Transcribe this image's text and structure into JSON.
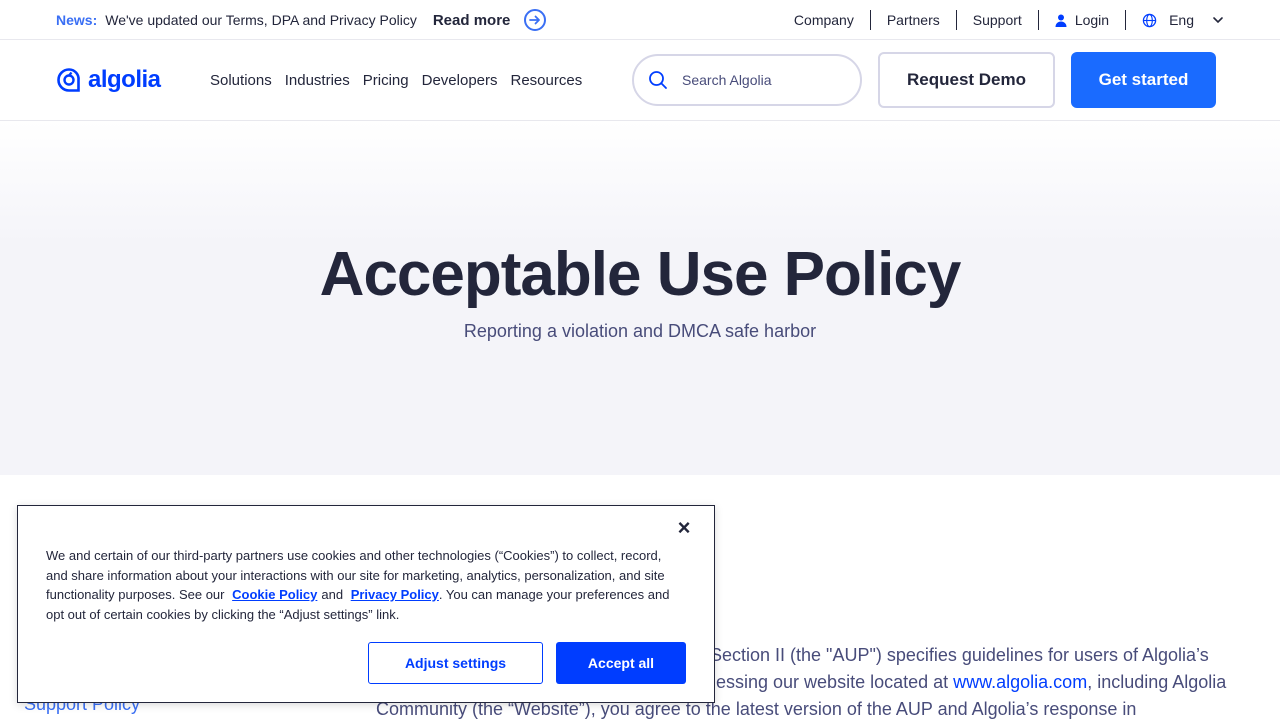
{
  "newsbar": {
    "tag": "News:",
    "text": "We've updated our Terms, DPA and Privacy Policy",
    "read_more": "Read more",
    "links": [
      "Company",
      "Partners",
      "Support"
    ],
    "login": "Login",
    "language": "Eng"
  },
  "header": {
    "logo": "algolia",
    "nav": [
      "Solutions",
      "Industries",
      "Pricing",
      "Developers",
      "Resources"
    ],
    "search_placeholder": "Search Algolia",
    "request_demo": "Request Demo",
    "get_started": "Get started"
  },
  "hero": {
    "title": "Acceptable Use Policy",
    "subtitle": "Reporting a violation and DMCA safe harbor"
  },
  "content": {
    "line1": "Section II (the \"AUP\") specifies guidelines for users of Algolia’s",
    "line2_pre": "essing our website located at ",
    "line2_link": "www.algolia.com",
    "line2_post": ", including Algolia",
    "line3": "Community (the “Website”), you agree to the latest version of the AUP and Algolia’s response in"
  },
  "sidebar": {
    "support_policy": "Support Policy"
  },
  "cookie": {
    "text1": "We and certain of our third-party partners use cookies and other technologies (“Cookies”) to collect, record, and share information about your interactions with our site for marketing, analytics, personalization, and site functionality purposes. See our",
    "cookie_policy": "Cookie Policy",
    "and": "and",
    "privacy_policy": "Privacy Policy",
    "text2": ". You can manage your preferences and opt out of certain cookies by clicking the “Adjust settings” link.",
    "close": "×",
    "adjust": "Adjust settings",
    "accept": "Accept all"
  },
  "colors": {
    "brand": "#003dff",
    "accent": "#1a6bff",
    "text": "#23263b"
  }
}
